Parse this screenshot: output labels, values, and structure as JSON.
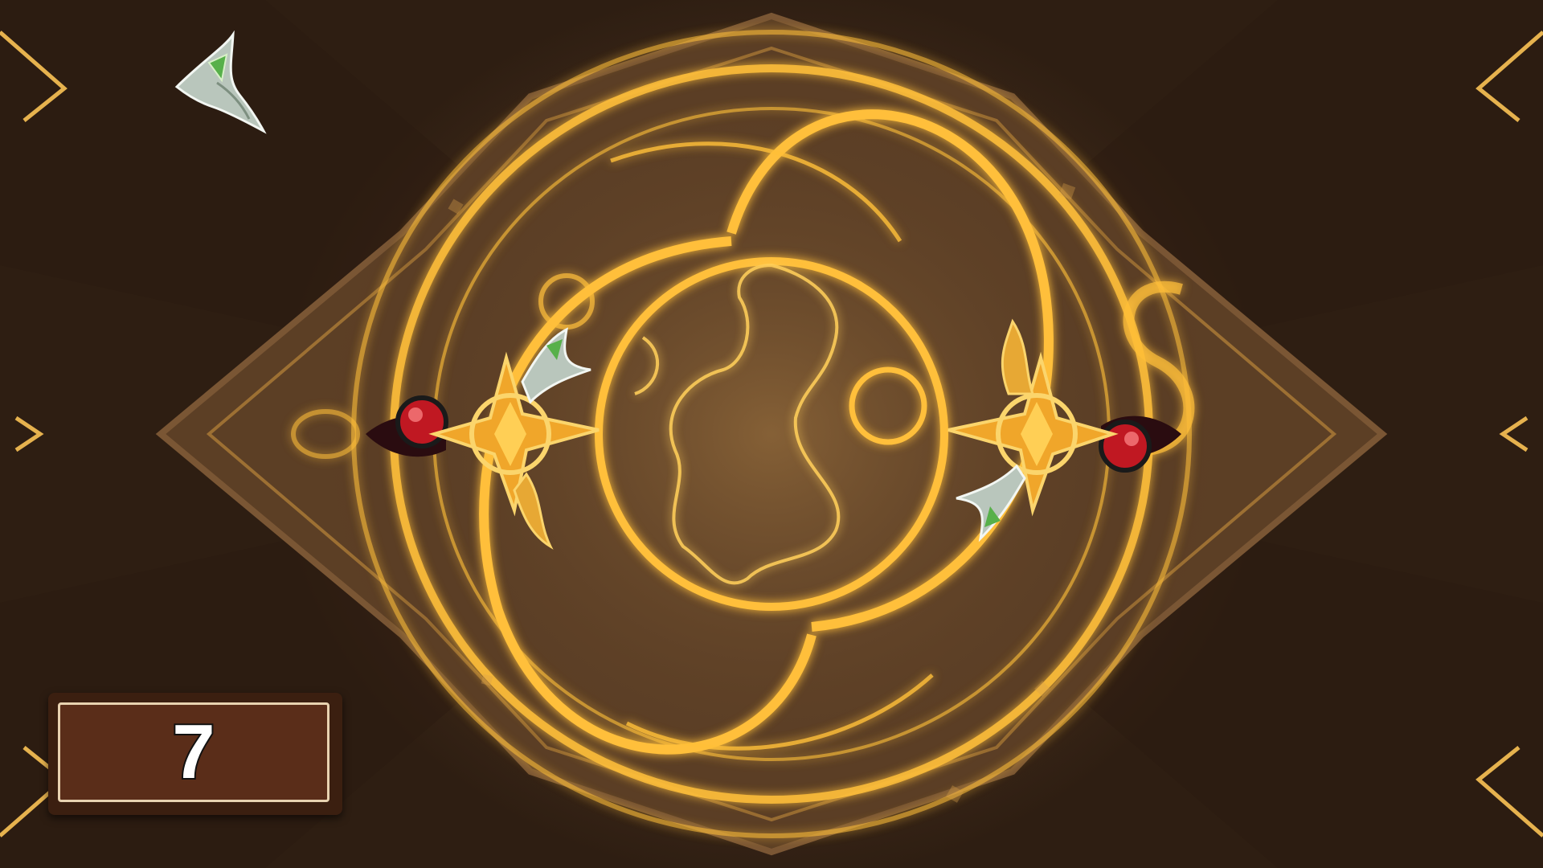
{
  "hud": {
    "counter_value": "7"
  },
  "colors": {
    "glow": "#ffc23a",
    "frame_dark": "#3b1f10",
    "panel_fill": "#5a2d19",
    "panel_border": "#e8d2b0"
  },
  "icons": {
    "top_left": "leaf-gem-icon",
    "left_piece": "gold-star-emblem-icon",
    "right_piece": "gold-star-emblem-icon",
    "board": "magic-circle-world-map"
  }
}
